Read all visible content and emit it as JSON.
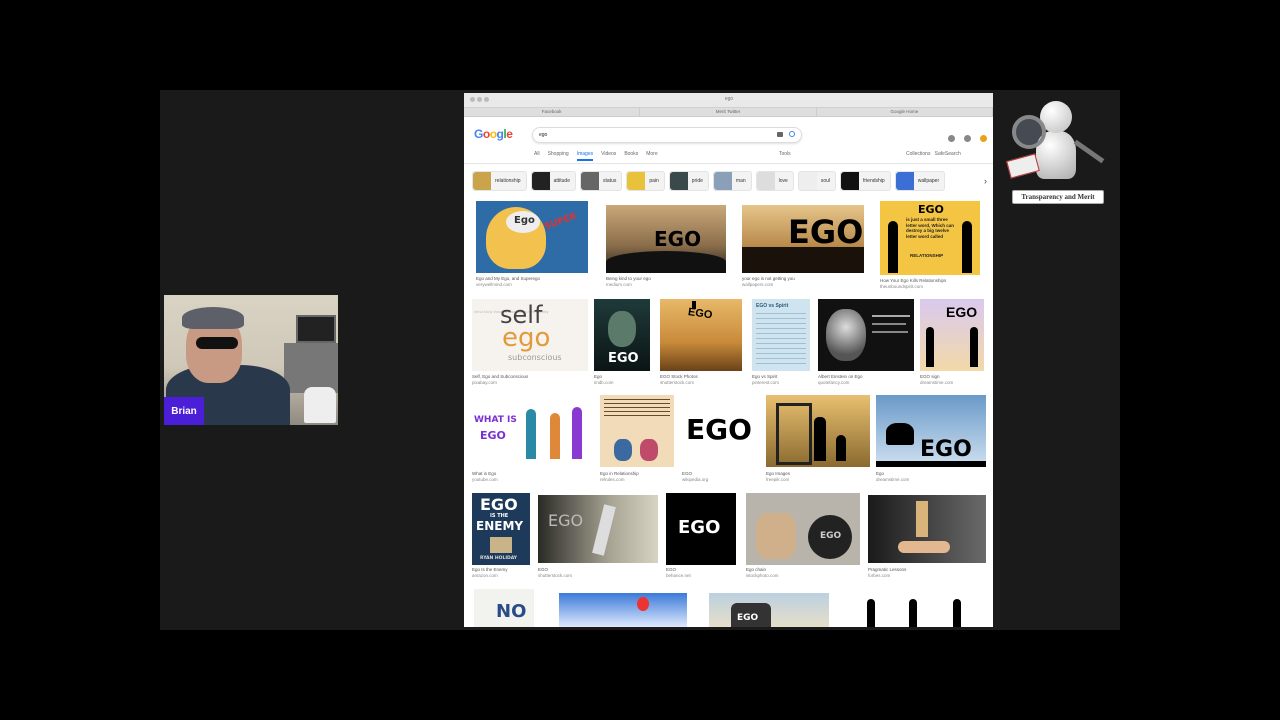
{
  "webcam": {
    "name": "Brian"
  },
  "logo": {
    "label": "Transparency and Merit"
  },
  "browser": {
    "address": "ego",
    "tabs": [
      "Facebook",
      "Merit Twitter",
      "Google Home"
    ],
    "search_query": "ego",
    "nav": [
      "All",
      "Shopping",
      "Images",
      "Videos",
      "Books",
      "More"
    ],
    "tools": "Tools",
    "collections": "Collections",
    "safesearch": "SafeSearch"
  },
  "chips": [
    "relationship",
    "attitude",
    "status",
    "pain",
    "pride",
    "man",
    "love",
    "soul",
    "friendship",
    "wallpaper"
  ],
  "results": {
    "r1": [
      {
        "cap1": "Ego and My Ego, and Superego",
        "cap2": "verywellmind.com"
      },
      {
        "cap1": "Being kind to your ego",
        "cap2": "medium.com"
      },
      {
        "cap1": "your ego is not getting you",
        "cap2": "wallpapers.com"
      },
      {
        "cap1": "How Your Ego Kills Relationships",
        "cap2": "theunboundspirit.com"
      }
    ],
    "r2": [
      {
        "cap1": "Self, Ego and Subconscious",
        "cap2": "pixabay.com"
      },
      {
        "cap1": "Ego",
        "cap2": "imdb.com"
      },
      {
        "cap1": "EGO Stock Photos",
        "cap2": "shutterstock.com"
      },
      {
        "cap1": "Ego vs Spirit",
        "cap2": "pinterest.com"
      },
      {
        "cap1": "Albert Einstein on Ego",
        "cap2": "quotefancy.com"
      },
      {
        "cap1": "EGO sign",
        "cap2": "dreamstime.com"
      }
    ],
    "r3": [
      {
        "cap1": "What is Ego",
        "cap2": "youtube.com"
      },
      {
        "cap1": "Ego in Relationship",
        "cap2": "relrules.com"
      },
      {
        "cap1": "EGO",
        "cap2": "wikipedia.org"
      },
      {
        "cap1": "Ego Images",
        "cap2": "freepik.com"
      },
      {
        "cap1": "Ego",
        "cap2": "dreamstime.com"
      }
    ],
    "r4": [
      {
        "cap1": "Ego Is the Enemy",
        "cap2": "amazon.com"
      },
      {
        "cap1": "EGO",
        "cap2": "shutterstock.com"
      },
      {
        "cap1": "EGO",
        "cap2": "behance.net"
      },
      {
        "cap1": "Ego chain",
        "cap2": "istockphoto.com"
      },
      {
        "cap1": "Pragmatic Lessons",
        "cap2": "forbes.com"
      }
    ],
    "r5": [
      {
        "cap1": "NO",
        "cap2": ""
      }
    ]
  },
  "image_text": {
    "ego_bubble": "Ego",
    "superego": "SUPER",
    "ego_sunset": "EGO",
    "ego_rock": "EGO",
    "ego_quote_title": "EGO",
    "ego_quote": "is just a small three letter word, Which can destroy a big twelve letter word called",
    "ego_quote_word": "RELATIONSHIP",
    "self": "self",
    "ego_cloud": "ego",
    "subconscious": "subconscious",
    "ego_poster": "EGO",
    "ego_stack": "EGO",
    "ego_vs": "EGO vs Spirit",
    "what_is": "WHAT IS",
    "what_ego": "EGO",
    "ego_big": "EGO",
    "ego_desk": "EGO",
    "book_ego": "EGO",
    "book_is": "IS THE",
    "book_enemy": "ENEMY",
    "book_author": "RYAN HOLIDAY",
    "ego_letters": "EGO",
    "ego_black": "EGO",
    "ego_ball": "EGO",
    "ego_blocks": "EGO",
    "no": "NO",
    "ego_weight": "EGO"
  },
  "colors": {
    "google_blue": "#4285f4",
    "google_red": "#ea4335",
    "google_yellow": "#fbbc05",
    "google_green": "#34a853",
    "nametag": "#4b1fd8"
  }
}
